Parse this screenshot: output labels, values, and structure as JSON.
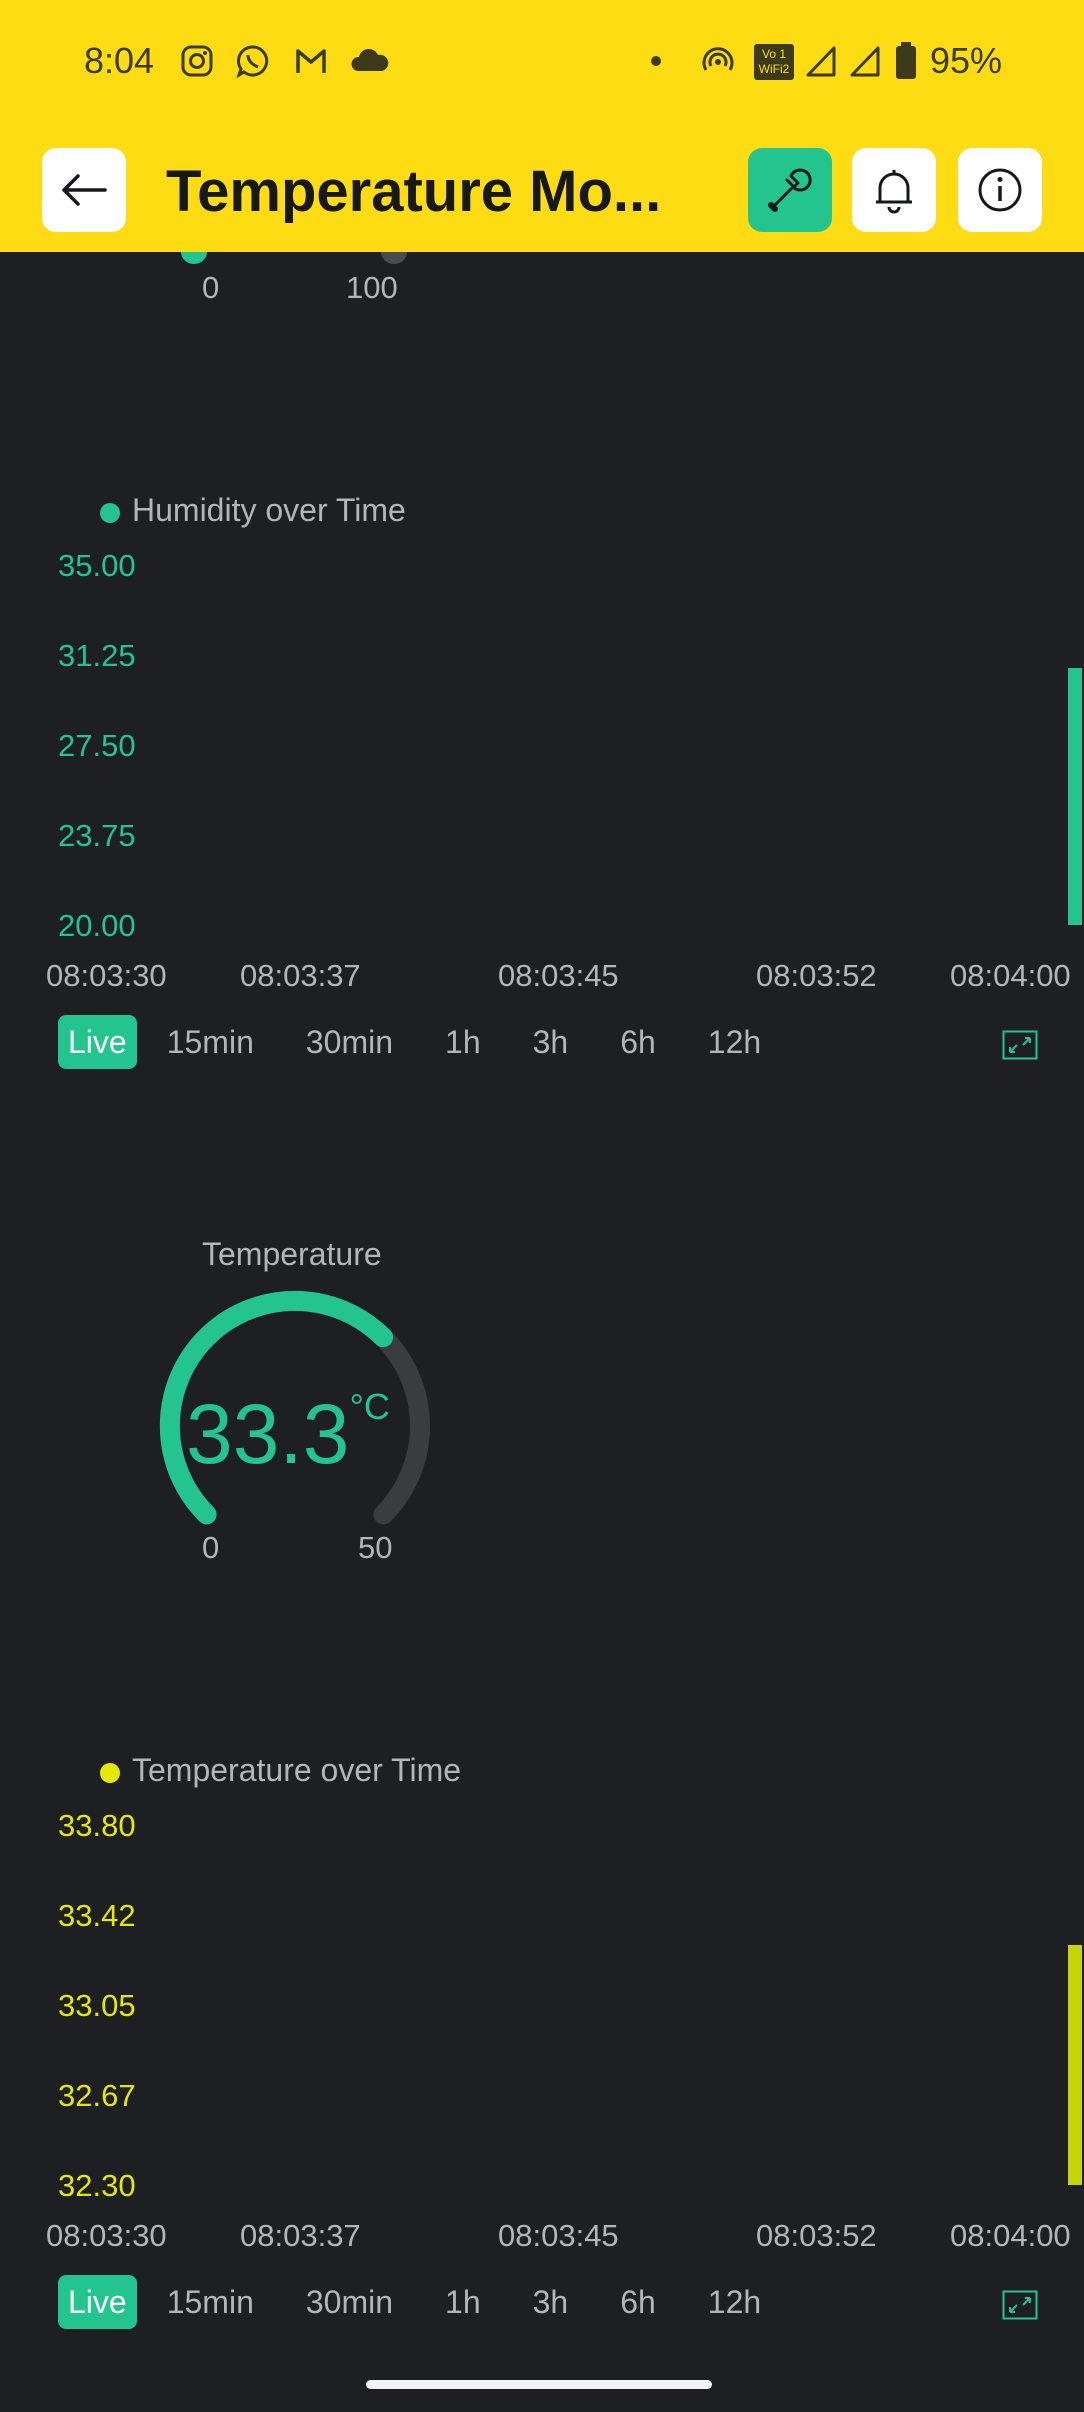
{
  "status_bar": {
    "time": "8:04",
    "battery": "95%",
    "vo_wifi_top": "Vo 1",
    "vo_wifi_bottom": "WiFi2",
    "icons": [
      "instagram-icon",
      "whatsapp-icon",
      "gmail-icon",
      "cloud-icon",
      "dot-icon",
      "hotspot-icon",
      "vowifi-icon",
      "signal-icon",
      "signal-icon",
      "battery-icon"
    ]
  },
  "app_bar": {
    "title": "Temperature Mo...",
    "accent": "#23c48e",
    "background": "#fddc14"
  },
  "top_gauge_partial": {
    "min_label": "0",
    "max_label": "100"
  },
  "humidity_chart": {
    "legend": "Humidity over Time",
    "y_ticks": [
      "35.00",
      "31.25",
      "27.50",
      "23.75",
      "20.00"
    ],
    "x_ticks": [
      "08:03:30",
      "08:03:37",
      "08:03:45",
      "08:03:52",
      "08:04:00"
    ],
    "color": "#23c48e"
  },
  "humidity_ranges": [
    "Live",
    "15min",
    "30min",
    "1h",
    "3h",
    "6h",
    "12h"
  ],
  "temperature_gauge": {
    "title": "Temperature",
    "value": "33.3",
    "unit": "°C",
    "min_label": "0",
    "max_label": "50",
    "fraction": 0.666
  },
  "temperature_chart": {
    "legend": "Temperature over Time",
    "y_ticks": [
      "33.80",
      "33.42",
      "33.05",
      "32.67",
      "32.30"
    ],
    "x_ticks": [
      "08:03:30",
      "08:03:37",
      "08:03:45",
      "08:03:52",
      "08:04:00"
    ],
    "color": "#c6d40a"
  },
  "temperature_ranges": [
    "Live",
    "15min",
    "30min",
    "1h",
    "3h",
    "6h",
    "12h"
  ],
  "chart_data": [
    {
      "type": "bar",
      "legend": "Humidity over Time",
      "x": [
        "08:03:30",
        "08:03:37",
        "08:03:45",
        "08:03:52",
        "08:04:00"
      ],
      "ylim": [
        20,
        35
      ],
      "points": [
        {
          "x": "08:04:00",
          "y": 30.7
        }
      ]
    },
    {
      "type": "bar",
      "legend": "Temperature over Time",
      "x": [
        "08:03:30",
        "08:03:37",
        "08:03:45",
        "08:03:52",
        "08:04:00"
      ],
      "ylim": [
        32.3,
        33.8
      ],
      "points": [
        {
          "x": "08:04:00",
          "y": 33.3
        }
      ]
    }
  ]
}
